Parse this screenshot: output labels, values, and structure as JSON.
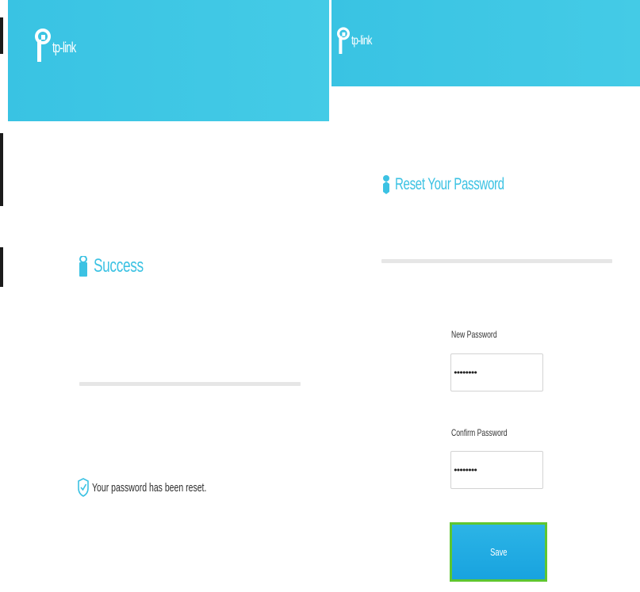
{
  "left_panel": {
    "logo": {
      "icon": "tp-link-logo-icon",
      "text": "tp-link"
    },
    "title": {
      "icon": "lock-icon",
      "text": "Success"
    },
    "message": {
      "icon": "shield-check-icon",
      "text": "Your password has been reset."
    }
  },
  "right_panel": {
    "logo": {
      "icon": "tp-link-logo-icon",
      "text": "tp-link"
    },
    "title": {
      "icon": "key-icon",
      "text": "Reset Your Password"
    },
    "new_password": {
      "label": "New Password",
      "value": "••••••••"
    },
    "confirm_password": {
      "label": "Confirm Password",
      "value": "••••••••"
    },
    "save_label": "Save"
  },
  "colors": {
    "header": "#3ec6e5",
    "title_text": "#3cc2e3",
    "button": "#1ea8e2",
    "button_highlight": "#5ec630"
  }
}
